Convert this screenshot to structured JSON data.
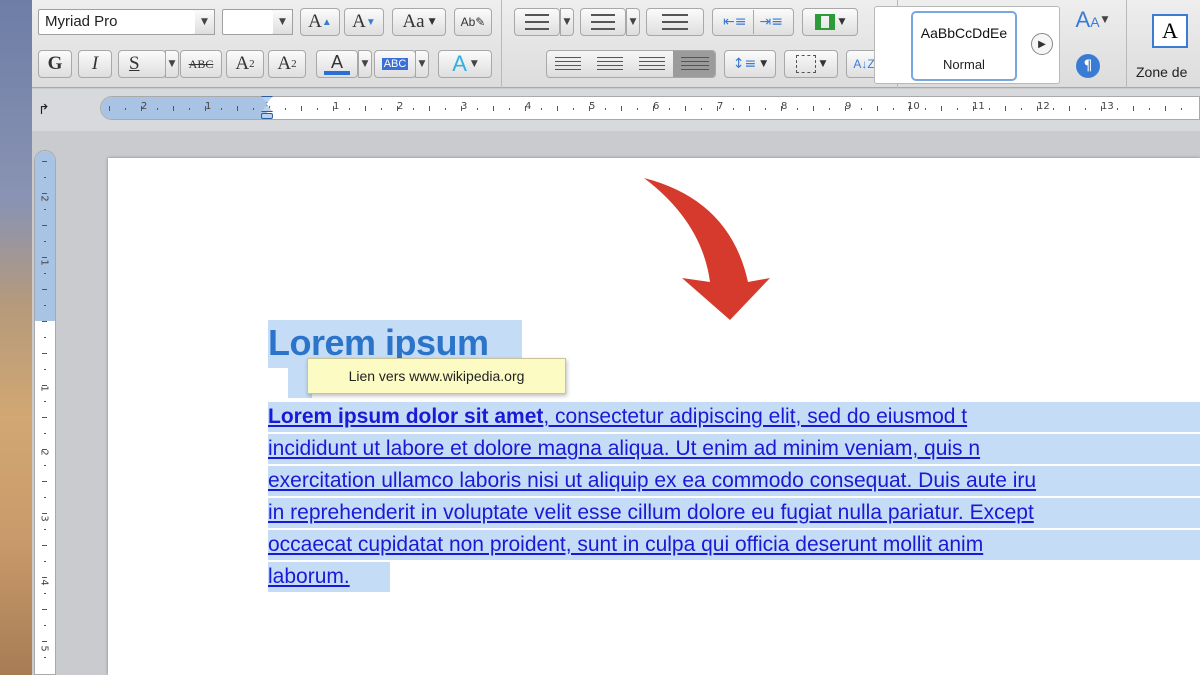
{
  "ribbon": {
    "font_name": "Myriad Pro",
    "font_size": "",
    "bold_label": "G",
    "italic_label": "I",
    "underline_label": "S",
    "strike_label": "ABC",
    "grow_font_label": "A",
    "shrink_font_label": "A",
    "change_case_label": "Aa",
    "superscript_label": "A",
    "subscript_label": "A",
    "font_color_label": "A",
    "highlight_label": "ABC",
    "text_effects_label": "A",
    "style_sample": "AaBbCcDdEe",
    "style_name": "Normal",
    "text_box_label": "Zone de",
    "font_color": "#2b6fd6",
    "highlight_color": "#3b6fd8"
  },
  "rulers": {
    "horizontal_numbers": [
      "2",
      "1",
      "1",
      "2",
      "3",
      "4",
      "5",
      "6",
      "7",
      "8",
      "9",
      "10",
      "11",
      "12",
      "13"
    ],
    "vertical_numbers": [
      "2",
      "1",
      "1",
      "2",
      "3",
      "4",
      "5"
    ]
  },
  "document": {
    "heading": "Lorem ipsum",
    "tooltip": "Lien vers www.wikipedia.org",
    "para_bold": "Lorem ipsum dolor sit amet",
    "para_lines": [
      ", consectetur adipiscing elit, sed do eiusmod t",
      "incididunt ut labore et dolore magna aliqua. Ut enim ad minim veniam, quis n",
      "exercitation ullamco laboris nisi ut aliquip ex ea commodo consequat. Duis aute iru",
      "in reprehenderit in voluptate velit esse cillum dolore eu fugiat nulla pariatur. Except",
      "occaecat cupidatat non proident, sunt in culpa qui officia deserunt mollit anim",
      "laborum."
    ],
    "link_color": "#1a1ad6",
    "selection_color": "#c4dcf5",
    "annotation_arrow_color": "#d63a2c"
  }
}
